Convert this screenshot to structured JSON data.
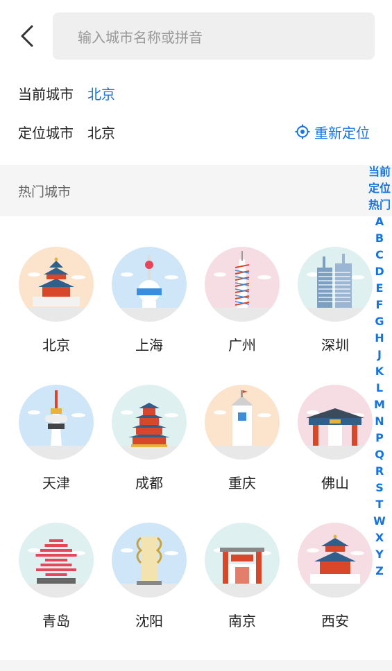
{
  "header": {
    "back_icon": "chevron-left-icon",
    "search_placeholder": "输入城市名称或拼音"
  },
  "current": {
    "label": "当前城市",
    "value": "北京"
  },
  "located": {
    "label": "定位城市",
    "value": "北京",
    "relocate_label": "重新定位",
    "relocate_icon": "crosshair-icon"
  },
  "hot": {
    "title": "热门城市"
  },
  "cities": [
    {
      "name": "北京",
      "bg": "#fbe3cc",
      "icon": "temple-of-heaven-icon"
    },
    {
      "name": "上海",
      "bg": "#cfe6f8",
      "icon": "oriental-pearl-tower-icon"
    },
    {
      "name": "广州",
      "bg": "#f6dde3",
      "icon": "canton-tower-icon"
    },
    {
      "name": "深圳",
      "bg": "#dff0f1",
      "icon": "skyscraper-icon"
    },
    {
      "name": "天津",
      "bg": "#cfe6f8",
      "icon": "tv-tower-icon"
    },
    {
      "name": "成都",
      "bg": "#dff0f1",
      "icon": "pagoda-icon"
    },
    {
      "name": "重庆",
      "bg": "#fbe3cc",
      "icon": "clock-tower-icon"
    },
    {
      "name": "佛山",
      "bg": "#f6dde3",
      "icon": "archway-icon"
    },
    {
      "name": "青岛",
      "bg": "#dff0f1",
      "icon": "wave-sculpture-icon"
    },
    {
      "name": "沈阳",
      "bg": "#cfe6f8",
      "icon": "column-monument-icon"
    },
    {
      "name": "南京",
      "bg": "#dff0f1",
      "icon": "gate-arch-icon"
    },
    {
      "name": "西安",
      "bg": "#f6dde3",
      "icon": "bell-tower-icon"
    }
  ],
  "index": [
    "当前",
    "定位",
    "热门",
    "A",
    "B",
    "C",
    "D",
    "E",
    "F",
    "G",
    "H",
    "J",
    "K",
    "L",
    "M",
    "N",
    "P",
    "Q",
    "R",
    "S",
    "T",
    "W",
    "X",
    "Y",
    "Z"
  ],
  "colors": {
    "accent": "#1673e6",
    "search_bg": "#efefef",
    "section_bg": "#f5f5f5"
  }
}
